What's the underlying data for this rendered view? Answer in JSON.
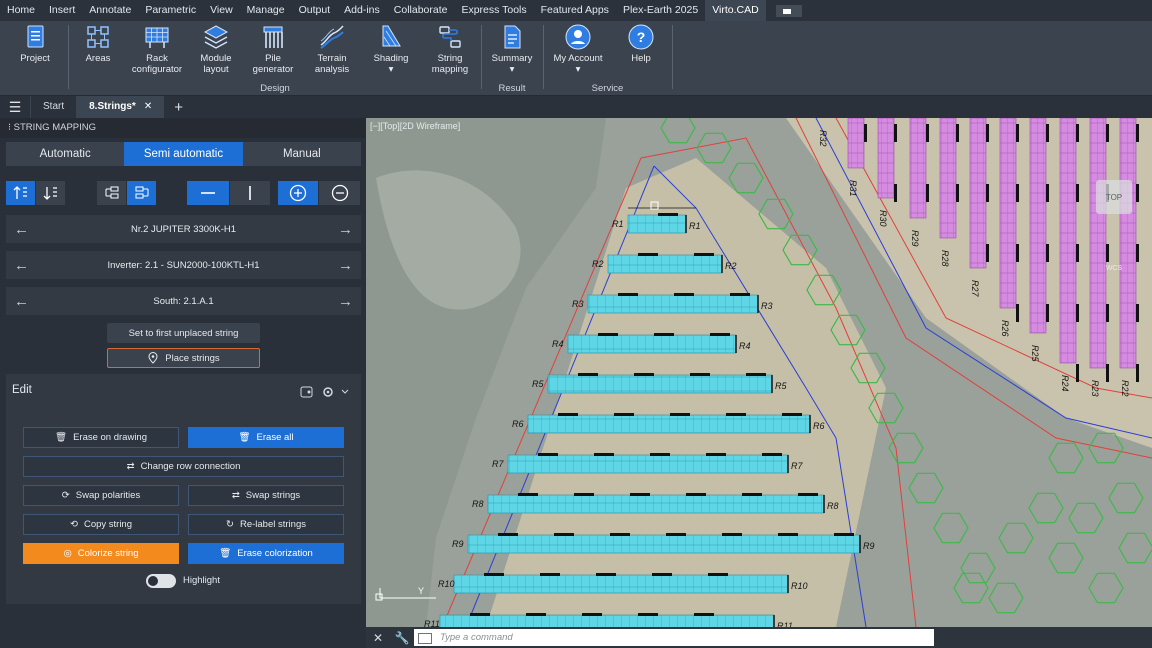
{
  "ribbon_tabs": [
    "Home",
    "Insert",
    "Annotate",
    "Parametric",
    "View",
    "Manage",
    "Output",
    "Add-ins",
    "Collaborate",
    "Express Tools",
    "Featured Apps",
    "Plex-Earth 2025",
    "Virto.CAD"
  ],
  "ribbon": {
    "project": "Project",
    "areas": "Areas",
    "rack_1": "Rack",
    "rack_2": "configurator",
    "module_1": "Module",
    "module_2": "layout",
    "pile_1": "Pile",
    "pile_2": "generator",
    "terrain_1": "Terrain",
    "terrain_2": "analysis",
    "shading": "Shading",
    "string_1": "String",
    "string_2": "mapping",
    "summary": "Summary",
    "account": "My Account",
    "help": "Help",
    "group_design": "Design",
    "group_result": "Result",
    "group_service": "Service"
  },
  "doc_tabs": {
    "start": "Start",
    "active": "8.Strings*"
  },
  "panel": {
    "title": "STRING MAPPING",
    "modes": [
      "Automatic",
      "Semi automatic",
      "Manual"
    ],
    "module": "Nr.2 JUPITER 3300K-H1",
    "inverter": "Inverter: 2.1 - SUN2000-100KTL-H1",
    "field": "South: 2.1.A.1",
    "set_first": "Set to first unplaced string",
    "place": "Place strings",
    "edit": "Edit",
    "erase_drawing": "Erase on drawing",
    "erase_all": "Erase all",
    "change_row": "Change row connection",
    "swap_polarities": "Swap polarities",
    "swap_strings": "Swap strings",
    "copy_string": "Copy string",
    "relabel": "Re-label strings",
    "colorize": "Colorize string",
    "erase_color": "Erase colorization",
    "highlight": "Highlight"
  },
  "viewport": {
    "label": "[−][Top][2D Wireframe]",
    "cube_label": "TOP",
    "wcs": "WCS",
    "command_placeholder": "Type a command",
    "rows_left": [
      "R1",
      "R2",
      "R3",
      "R4",
      "R5",
      "R6",
      "R7",
      "R8",
      "R9",
      "R10",
      "R11"
    ],
    "rows_right": [
      "R32",
      "R31",
      "R30",
      "R29",
      "R28",
      "R27",
      "R26",
      "R25",
      "R24",
      "R23",
      "R22"
    ]
  },
  "colors": {
    "accent": "#1d6fd6",
    "orange": "#f28a1e",
    "string": "#5fd6e6",
    "boundary_red": "#e0403a",
    "boundary_blue": "#2a3fd4",
    "magenta": "#d58be0"
  }
}
